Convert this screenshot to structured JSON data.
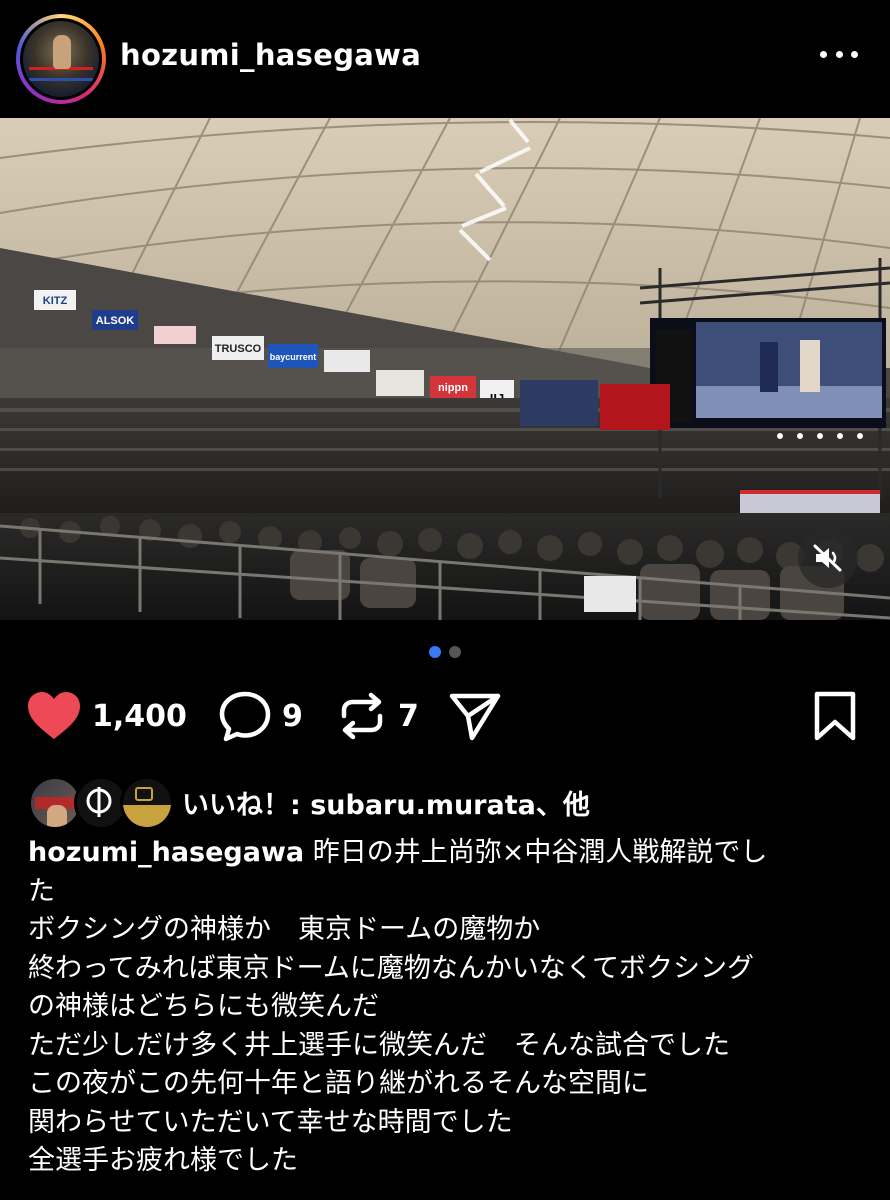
{
  "post": {
    "username": "hozumi_hasegawa",
    "more_icon": "more-horizontal-icon"
  },
  "media": {
    "mute_icon": "speaker-muted-icon",
    "carousel_count": 2,
    "carousel_active": 1,
    "accent": "#3a7bf5",
    "signs": [
      "KITZ",
      "ALSOK",
      "TRUSCO",
      "baycurrent",
      "nippn",
      "IIJ"
    ]
  },
  "actions": {
    "like_count": "1,400",
    "comment_count": "9",
    "repost_count": "7",
    "like_color": "#ed4956",
    "icons": [
      "heart-filled-icon",
      "comment-icon",
      "repost-icon",
      "send-icon",
      "bookmark-icon"
    ]
  },
  "likes": {
    "text": "いいね！: subaru.murata、他"
  },
  "caption": {
    "username": "hozumi_hasegawa",
    "first_line": " 昨日の井上尚弥×中谷潤人戦解説でし",
    "lines": [
      "た",
      "ボクシングの神様か　東京ドームの魔物か",
      "終わってみれば東京ドームに魔物なんかいなくてボクシング",
      "の神様はどちらにも微笑んだ",
      "ただ少しだけ多く井上選手に微笑んだ　そんな試合でした",
      "この夜がこの先何十年と語り継がれるそんな空間に",
      "関わらせていただいて幸せな時間でした",
      "全選手お疲れ様でした"
    ]
  }
}
